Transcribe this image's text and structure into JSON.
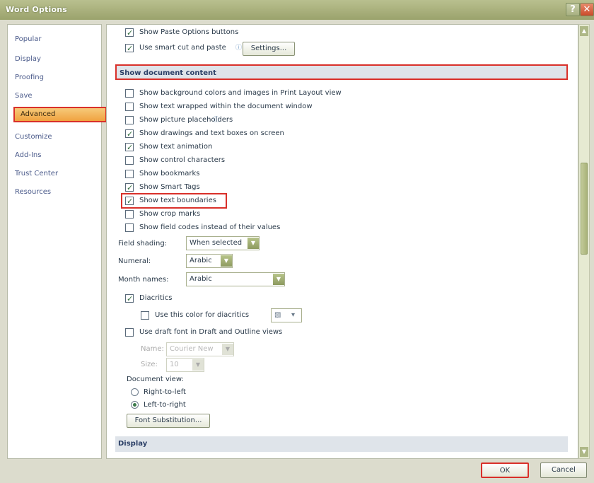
{
  "window": {
    "title": "Word Options"
  },
  "sidebar": {
    "items": [
      {
        "label": "Popular"
      },
      {
        "label": "Display"
      },
      {
        "label": "Proofing"
      },
      {
        "label": "Save"
      },
      {
        "label": "Advanced"
      },
      {
        "label": "Customize"
      },
      {
        "label": "Add-Ins"
      },
      {
        "label": "Trust Center"
      },
      {
        "label": "Resources"
      }
    ],
    "active": "Advanced"
  },
  "top_options": [
    {
      "label": "Show Paste Options buttons",
      "checked": true
    },
    {
      "label": "Use smart cut and paste",
      "checked": true
    }
  ],
  "settings_button": "Settings...",
  "sections": {
    "show_document_content": "Show document content",
    "display": "Display"
  },
  "content_options": [
    {
      "label": "Show background colors and images in Print Layout view",
      "checked": false
    },
    {
      "label": "Show text wrapped within the document window",
      "checked": false
    },
    {
      "label": "Show picture placeholders",
      "checked": false
    },
    {
      "label": "Show drawings and text boxes on screen",
      "checked": true
    },
    {
      "label": "Show text animation",
      "checked": true
    },
    {
      "label": "Show control characters",
      "checked": false
    },
    {
      "label": "Show bookmarks",
      "checked": false
    },
    {
      "label": "Show Smart Tags",
      "checked": true
    },
    {
      "label": "Show text boundaries",
      "checked": true
    },
    {
      "label": "Show crop marks",
      "checked": false
    },
    {
      "label": "Show field codes instead of their values",
      "checked": false
    }
  ],
  "field_shading": {
    "label": "Field shading:",
    "value": "When selected"
  },
  "numeral": {
    "label": "Numeral:",
    "value": "Arabic"
  },
  "month_names": {
    "label": "Month names:",
    "value": "Arabic"
  },
  "diacritics": {
    "label": "Diacritics",
    "checked": true
  },
  "diacritics_color": {
    "label": "Use this color for diacritics",
    "checked": false
  },
  "draft_font": {
    "label": "Use draft font in Draft and Outline views",
    "checked": false
  },
  "font_name": {
    "label": "Name:",
    "value": "Courier New"
  },
  "font_size": {
    "label": "Size:",
    "value": "10"
  },
  "document_view": {
    "label": "Document view:",
    "options": [
      {
        "label": "Right-to-left",
        "selected": false
      },
      {
        "label": "Left-to-right",
        "selected": true
      }
    ]
  },
  "font_substitution_button": "Font Substitution...",
  "footer": {
    "ok": "OK",
    "cancel": "Cancel"
  },
  "icons": {
    "help": "help-icon",
    "close": "close-icon"
  },
  "colors": {
    "highlight": "#d9302a",
    "active_tab": "#f0a340"
  }
}
